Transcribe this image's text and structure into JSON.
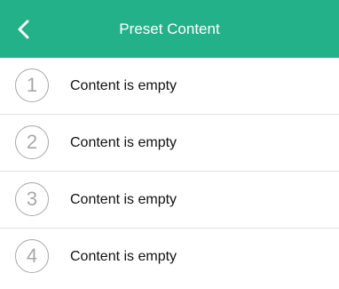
{
  "header": {
    "title": "Preset Content",
    "back_icon": "chevron-left-icon",
    "background_color": "#22b189"
  },
  "list": {
    "items": [
      {
        "number": "1",
        "text": "Content is empty"
      },
      {
        "number": "2",
        "text": "Content is empty"
      },
      {
        "number": "3",
        "text": "Content is empty"
      },
      {
        "number": "4",
        "text": "Content is empty"
      }
    ]
  }
}
